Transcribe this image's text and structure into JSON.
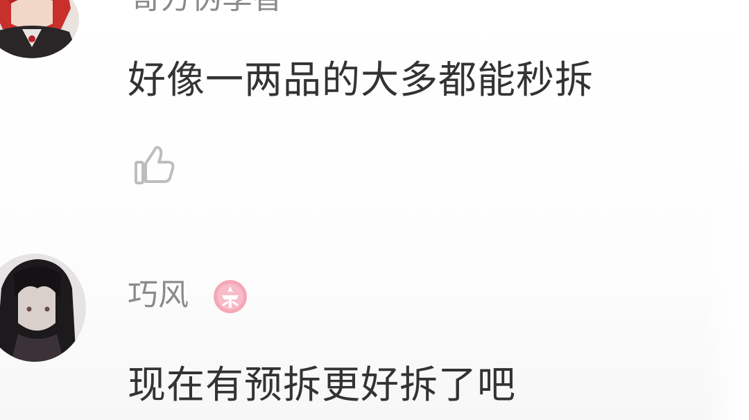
{
  "comments": [
    {
      "username": "哥方伪季香",
      "text": "好像一两品的大多都能秒拆",
      "avatar_icon": "red-hair-character-avatar",
      "like_icon": "thumbs-up-icon"
    },
    {
      "username": "巧风",
      "text": "现在有预拆更好拆了吧",
      "avatar_icon": "black-hair-character-avatar",
      "badge_icon": "level-badge-icon"
    }
  ],
  "colors": {
    "username": "#8a8a8a",
    "comment_text": "#333333",
    "icon_gray": "#bfbfbf",
    "badge_pink": "#f4a8b6"
  }
}
